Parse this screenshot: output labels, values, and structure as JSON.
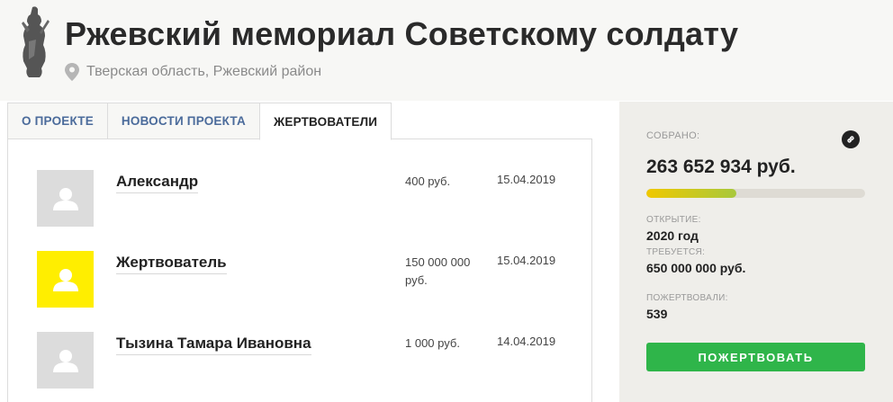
{
  "header": {
    "title": "Ржевский мемориал Советскому солдату",
    "location": "Тверская область, Ржевский район",
    "logo_icon": "soldier-monument-icon",
    "location_icon": "map-pin-icon"
  },
  "tabs": [
    {
      "label": "О ПРОЕКТЕ",
      "active": false
    },
    {
      "label": "НОВОСТИ ПРОЕКТА",
      "active": false
    },
    {
      "label": "ЖЕРТВОВАТЕЛИ",
      "active": true
    }
  ],
  "donors": [
    {
      "name": "Александр",
      "amount": "400 руб.",
      "date": "15.04.2019",
      "avatar_color": "#dcdcdc"
    },
    {
      "name": "Жертвователь",
      "amount": "150 000 000 руб.",
      "date": "15.04.2019",
      "avatar_color": "#ffee00"
    },
    {
      "name": "Тызина Тамара Ивановна",
      "amount": "1 000 руб.",
      "date": "14.04.2019",
      "avatar_color": "#dcdcdc"
    }
  ],
  "sidebar": {
    "collected_label": "СОБРАНО:",
    "collected_value": "263 652 934 руб.",
    "progress_fraction": 0.41,
    "opening_label": "ОТКРЫТИЕ:",
    "opening_value": "2020 год",
    "required_label": "ТРЕБУЕТСЯ:",
    "required_value": "650 000 000 руб.",
    "donated_label": "ПОЖЕРТВОВАЛИ:",
    "donated_value": "539",
    "donate_button": "ПОЖЕРТВОВАТЬ",
    "link_icon": "link-icon"
  },
  "colors": {
    "accent_green": "#2fb54a",
    "tab_link": "#4b6b9b",
    "highlight_avatar": "#ffee00",
    "sidebar_bg": "#efeeea"
  }
}
